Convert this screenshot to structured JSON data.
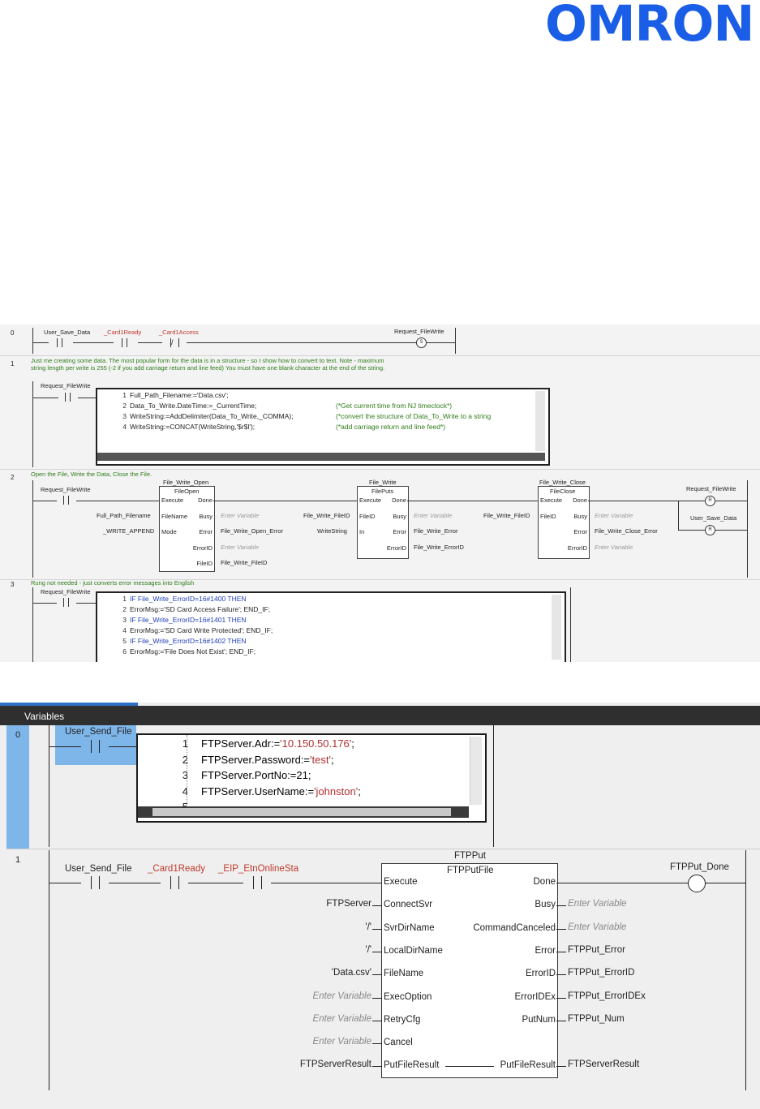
{
  "brand": {
    "logo": "OMRON",
    "color": "#1a5ee8"
  },
  "ladder1": {
    "rung0": {
      "number": "0",
      "contact1": "User_Save_Data",
      "contact2": "_Card1Ready",
      "contact3": "_Card1Access",
      "coil": "Request_FileWrite",
      "coil_symbol": "S"
    },
    "rung1": {
      "number": "1",
      "comment": "Just me creating some data. The most popular form for the data is in a structure - so I show how to convert to text. Note - maximum string length per write is 255 (-2 if you add carriage return and line feed) You must have one blank character at the end of the string.",
      "contact": "Request_FileWrite",
      "code": [
        {
          "n": "1",
          "text": "Full_Path_Filename:='Data.csv';",
          "comment": ""
        },
        {
          "n": "2",
          "text": "Data_To_Write.DateTime:=_CurrentTime;",
          "comment": "(*Get current time from NJ timeclock*)"
        },
        {
          "n": "3",
          "text": "WriteString:=AddDelimiter(Data_To_Write,_COMMA);",
          "comment": "(*convert the structure of Data_To_Write to a string"
        },
        {
          "n": "4",
          "text": "WriteString:=CONCAT(WriteString,'$r$l');",
          "comment": "(*add carriage return and line feed*)"
        }
      ]
    },
    "rung2": {
      "number": "2",
      "comment": "Open the File, Write the Data, Close the File.",
      "contact": "Request_FileWrite",
      "fb_open": {
        "instance": "File_Write_Open",
        "type": "FileOpen",
        "in_execute": "Execute",
        "in_filename": "FileName",
        "in_mode": "Mode",
        "out_done": "Done",
        "out_busy": "Busy",
        "out_error": "Error",
        "out_errorid": "ErrorID",
        "out_fileid": "FileID",
        "arg_filename": "Full_Path_Filename",
        "arg_mode": "_WRITE_APPEND",
        "busy_var": "Enter Variable",
        "error_var": "File_Write_Open_Error",
        "errorid_var": "Enter Variable",
        "fileid_var": "File_Write_FileID"
      },
      "fb_write": {
        "instance": "File_Write",
        "type": "FilePuts",
        "in_execute": "Execute",
        "in_fileid": "FileID",
        "in_in": "In",
        "out_done": "Done",
        "out_busy": "Busy",
        "out_error": "Error",
        "out_errorid": "ErrorID",
        "arg_fileid": "File_Write_FileID",
        "arg_in": "WriteString",
        "busy_var": "Enter Variable",
        "error_var": "File_Write_Error",
        "errorid_var": "File_Write_ErrorID"
      },
      "fb_close": {
        "instance": "File_Write_Close",
        "type": "FileClose",
        "in_execute": "Execute",
        "in_fileid": "FileID",
        "out_done": "Done",
        "out_busy": "Busy",
        "out_error": "Error",
        "out_errorid": "ErrorID",
        "arg_fileid": "File_Write_FileID",
        "busy_var": "Enter Variable",
        "error_var": "File_Write_Close_Error",
        "errorid_var": "Enter Variable"
      },
      "coil1": "Request_FileWrite",
      "coil2": "User_Save_Data",
      "coil_symbol": "R"
    },
    "rung3": {
      "number": "3",
      "comment": "Rung not needed - just converts error messages into English",
      "contact": "Request_FileWrite",
      "code": [
        {
          "n": "1",
          "text": "IF File_Write_ErrorID=16#1400 THEN"
        },
        {
          "n": "2",
          "text": "ErrorMsg:='SD Card Access Failure'; END_IF;"
        },
        {
          "n": "3",
          "text": "IF File_Write_ErrorID=16#1401 THEN"
        },
        {
          "n": "4",
          "text": "ErrorMsg:='SD Card Write Protected'; END_IF;"
        },
        {
          "n": "5",
          "text": "IF File_Write_ErrorID=16#1402 THEN"
        },
        {
          "n": "6",
          "text": "ErrorMsg:='File Does Not Exist'; END_IF;"
        }
      ]
    }
  },
  "ladder2": {
    "panel_title": "Variables",
    "rung0": {
      "number": "0",
      "contact": "User_Send_File",
      "code": [
        {
          "n": "1",
          "pre": "FTPServer.Adr:=",
          "str": "'10.150.50.176'",
          "post": ";"
        },
        {
          "n": "2",
          "pre": "FTPServer.Password:=",
          "str": "'test'",
          "post": ";"
        },
        {
          "n": "3",
          "pre": "FTPServer.PortNo:=21;",
          "str": "",
          "post": ""
        },
        {
          "n": "4",
          "pre": "FTPServer.UserName:=",
          "str": "'johnston'",
          "post": ";"
        },
        {
          "n": "5",
          "pre": "",
          "str": "",
          "post": ""
        }
      ]
    },
    "rung1": {
      "number": "1",
      "contact1": "User_Send_File",
      "contact2": "_Card1Ready",
      "contact3": "_EIP_EtnOnlineSta",
      "fb_instance": "FTPPut",
      "fb_type": "FTPPutFile",
      "inputs": [
        {
          "arg": "",
          "pin": "Execute",
          "placeholder": false
        },
        {
          "arg": "FTPServer",
          "pin": "ConnectSvr",
          "placeholder": false
        },
        {
          "arg": "'/'",
          "pin": "SvrDirName",
          "placeholder": false
        },
        {
          "arg": "'/'",
          "pin": "LocalDirName",
          "placeholder": false
        },
        {
          "arg": "'Data.csv'",
          "pin": "FileName",
          "placeholder": false
        },
        {
          "arg": "Enter Variable",
          "pin": "ExecOption",
          "placeholder": true
        },
        {
          "arg": "Enter Variable",
          "pin": "RetryCfg",
          "placeholder": true
        },
        {
          "arg": "Enter Variable",
          "pin": "Cancel",
          "placeholder": true
        },
        {
          "arg": "FTPServerResult",
          "pin": "PutFileResult",
          "placeholder": false
        }
      ],
      "outputs": [
        {
          "pin": "Done",
          "var": "",
          "placeholder": false
        },
        {
          "pin": "Busy",
          "var": "Enter Variable",
          "placeholder": true
        },
        {
          "pin": "CommandCanceled",
          "var": "Enter Variable",
          "placeholder": true
        },
        {
          "pin": "Error",
          "var": "FTPPut_Error",
          "placeholder": false
        },
        {
          "pin": "ErrorID",
          "var": "FTPPut_ErrorID",
          "placeholder": false
        },
        {
          "pin": "ErrorIDEx",
          "var": "FTPPut_ErrorIDEx",
          "placeholder": false
        },
        {
          "pin": "PutNum",
          "var": "FTPPut_Num",
          "placeholder": false
        },
        {
          "pin": "PutFileResult",
          "var": "FTPServerResult",
          "placeholder": false
        }
      ],
      "coil": "FTPPut_Done"
    }
  }
}
